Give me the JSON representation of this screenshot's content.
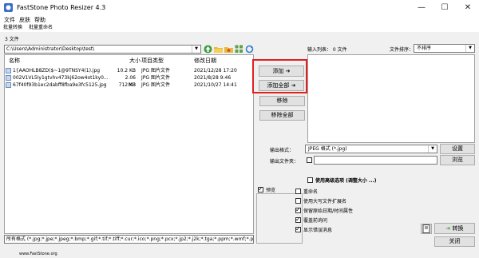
{
  "window": {
    "title": "FastStone Photo Resizer 4.3",
    "controls": [
      "—",
      "☐",
      "✕"
    ]
  },
  "menu": [
    "文件",
    "皮肤",
    "帮助"
  ],
  "tabs": [
    "批量转换",
    "批量重命名"
  ],
  "file_count": "3 文件",
  "path": "C:\\Users\\Administrator\\Desktop\\test\\",
  "file_list": {
    "headers": {
      "name": "名称",
      "size": "大小",
      "type": "项目类型",
      "date": "修改日期"
    },
    "rows": [
      {
        "name": "1{AAOHLB8ZD($~1@9TNSY4(1).jpg",
        "size": "10.2 KB",
        "type": "JPG 图片文件",
        "date": "2021/12/28 17:20"
      },
      {
        "name": "002V1VL5Iy1gtvhv473kj62ow4ot1ky0...",
        "size": "2.06 MB",
        "type": "JPG 图片文件",
        "date": "2021/8/28 9:46"
      },
      {
        "name": "67f40f93b1ec2dabff8fba9e3fc5125.jpg",
        "size": "712 KB",
        "type": "JPG 图片文件",
        "date": "2021/10/27 14:41"
      }
    ]
  },
  "filter": "所有格式 (*.jpg;*.jpe;*.jpeg;*.bmp;*.gif;*.tif;*.tiff;*.cur;*.ico;*.png;*.pcx;*.jp2;*.j2k;*.tga;*.ppm;*.wmf;*.p",
  "buttons": {
    "add": "添加",
    "add_all": "添加全部",
    "remove": "移除",
    "remove_all": "移除全部"
  },
  "input_list": "输入列表： 0 文件",
  "sort": {
    "label": "文件排序：",
    "value": "不排序"
  },
  "output_format": {
    "label": "输出格式：",
    "value": "JPEG 格式 (*.jpg)",
    "settings": "设置"
  },
  "output_folder": {
    "label": "输出文件夹：",
    "value": "",
    "browse": "浏览"
  },
  "preview": "预览",
  "options": [
    {
      "label": "使用高级选项 (调整大小 ...)",
      "checked": false
    },
    {
      "label": "重命名",
      "checked": false
    },
    {
      "label": "使用大写文件扩展名",
      "checked": false
    },
    {
      "label": "保留原始日期/时间属性",
      "checked": true
    },
    {
      "label": "覆盖前询问",
      "checked": true
    },
    {
      "label": "显示错误消息",
      "checked": true
    }
  ],
  "actions": {
    "convert": "转换",
    "close": "关闭"
  },
  "status": "www.FastStone.org",
  "colors": {
    "highlight": "#e02020",
    "convert_arrow": "#2aa02a"
  }
}
